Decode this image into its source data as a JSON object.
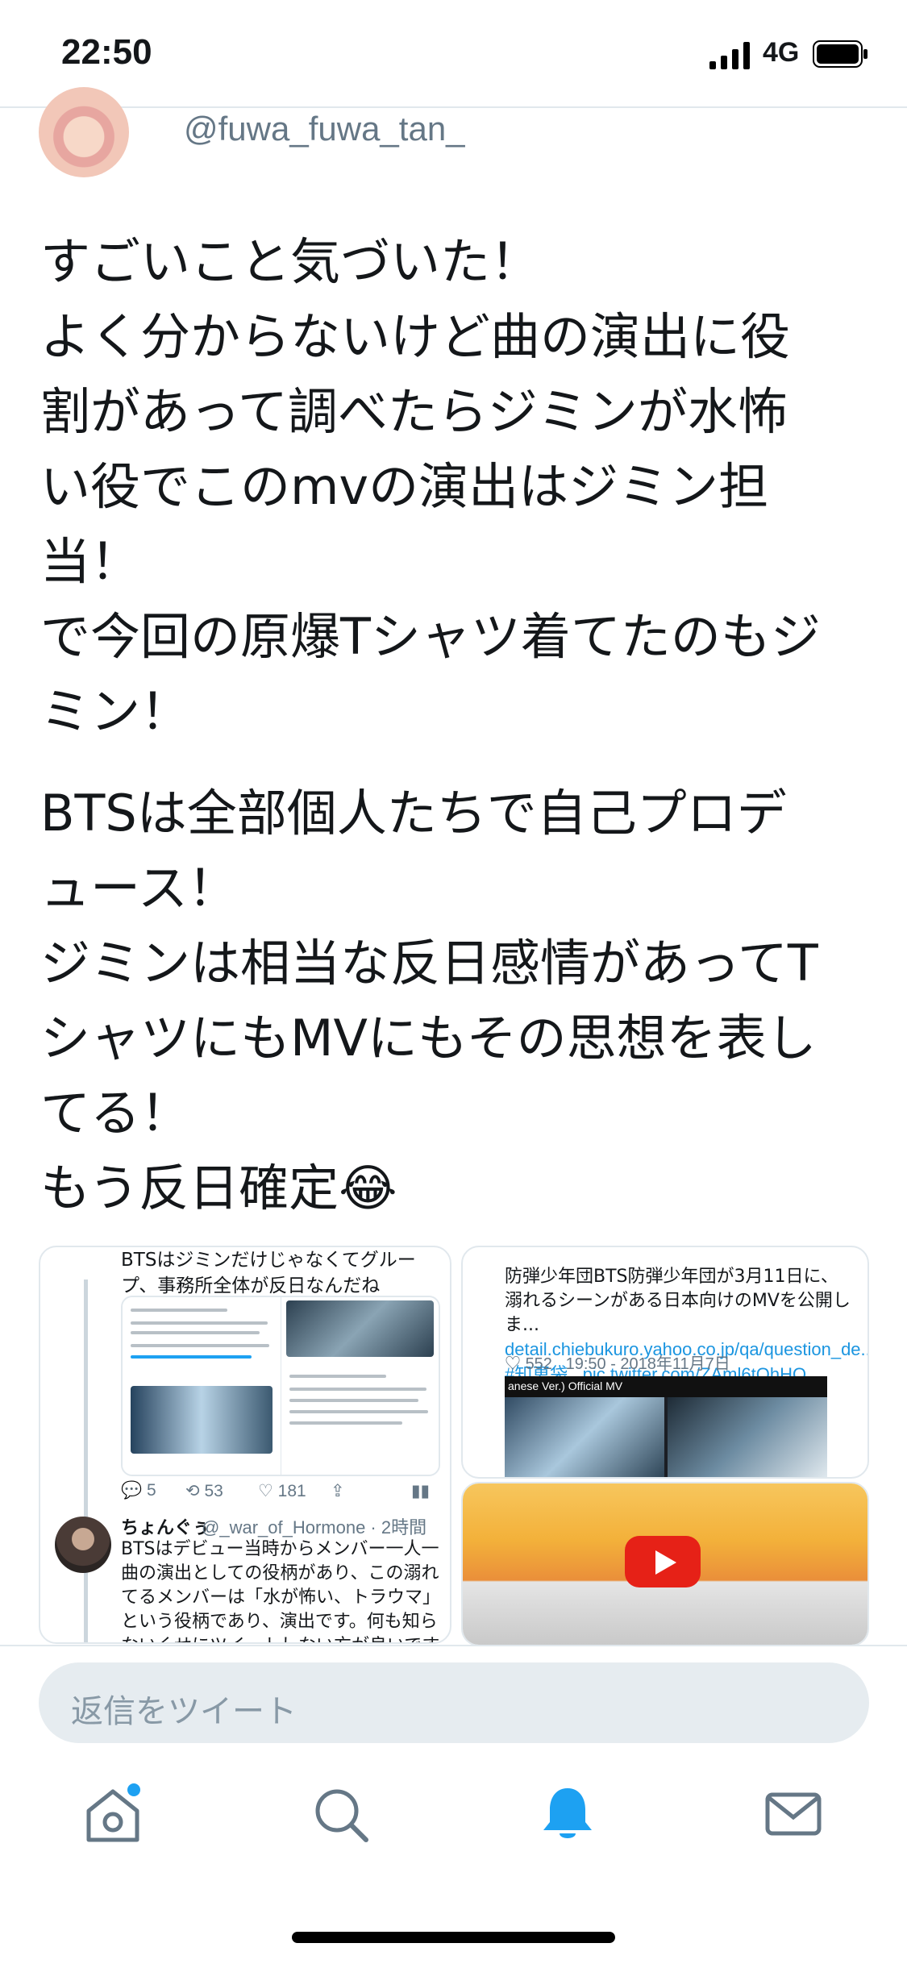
{
  "status_bar": {
    "time": "22:50",
    "network": "4G",
    "icons": [
      "signal-icon",
      "battery-icon"
    ]
  },
  "tweet": {
    "handle": "@fuwa_fuwa_tan_",
    "lines": [
      "すごいこと気づいた！",
      "よく分からないけど曲の演出に役",
      "割があって調べたらジミンが水怖",
      "い役でこのmvの演出はジミン担",
      "当！",
      "で今回の原爆Tシャツ着てたのもジ",
      "ミン！",
      "BTSは全部個人たちで自己プロデ",
      "ュース！",
      "ジミンは相当な反日感情があってT",
      "シャツにもMVにもその思想を表し",
      "てる！",
      "もう反日確定😂"
    ]
  },
  "quoted_left": {
    "text": "BTSはジミンだけじゃなくてグループ、事務所全体が反日なんだね",
    "counts": {
      "reply": "5",
      "retweet": "53",
      "like": "181"
    },
    "reply_author": "ちょんぐぅ",
    "reply_meta": "@_war_of_Hormone · 2時間",
    "reply_text": "BTSはデビュー当時からメンバー一人一曲の演出としての役柄があり、この溺れてるメンバーは「水が怖い、トラウマ」という役柄であり、演出です。何も知らないくせにツイートしない方が良いですよ〜〜"
  },
  "quoted_right": {
    "text": "防弾少年団BTS防弾少年団が3月11日に、溺れるシーンがある日本向けのMVを公開しま...",
    "link": "detail.chiebukuro.yahoo.co.jp/qa/question_de...",
    "hashtags": "#知恵袋_ pic.twitter.com/ZAml6tQhHO",
    "likes": "552",
    "time": "19:50 - 2018年11月7日",
    "video_caption": "anese Ver.) Official MV"
  },
  "reply_box": {
    "placeholder": "返信をツイート"
  },
  "tabbar": {
    "items": [
      "home-icon",
      "search-icon",
      "notifications-icon",
      "messages-icon"
    ],
    "active": "notifications-icon"
  },
  "colors": {
    "accent": "#1da1f2",
    "text": "#14171a",
    "muted": "#657786",
    "reply_bg": "#e6ecf0"
  }
}
